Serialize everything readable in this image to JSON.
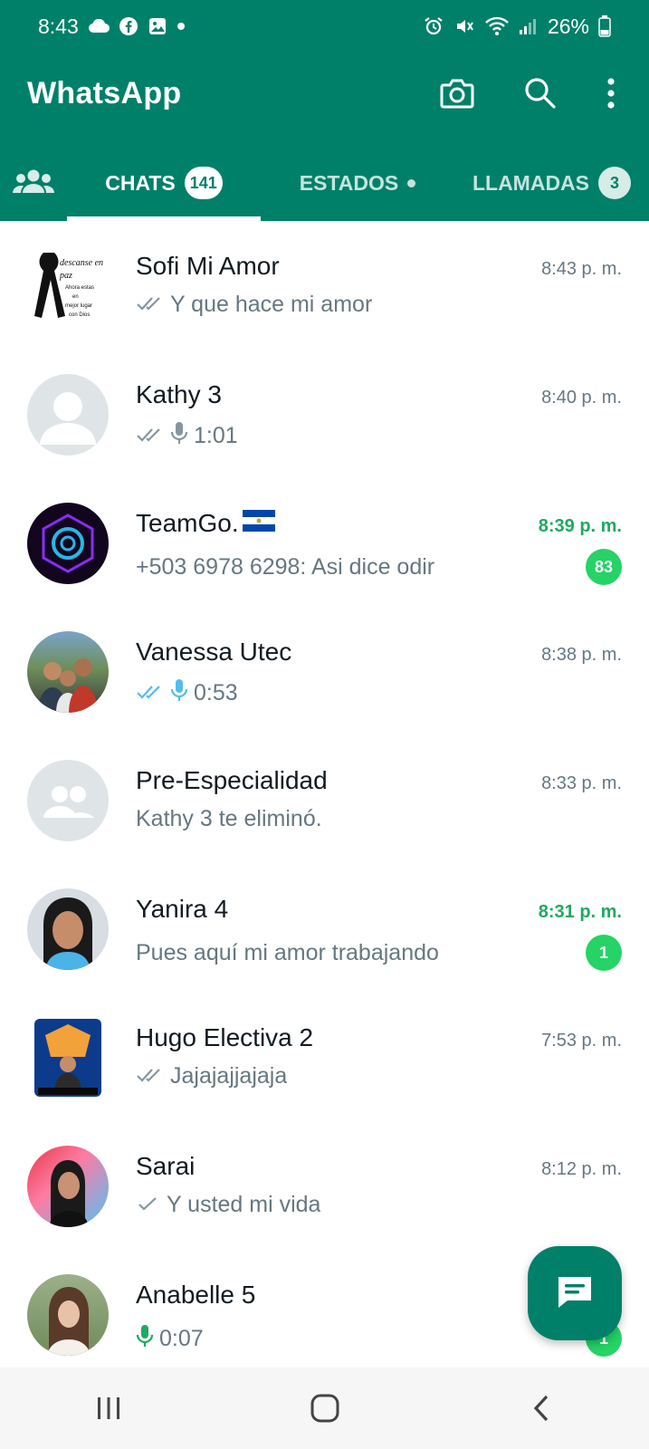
{
  "status_bar": {
    "time": "8:43",
    "battery": "26%",
    "left_icons": [
      "cloud-icon",
      "facebook-icon",
      "gallery-icon",
      "dot-icon"
    ],
    "right_icons": [
      "alarm-icon",
      "mute-icon",
      "wifi-icon",
      "signal-icon",
      "battery-icon"
    ]
  },
  "app": {
    "title": "WhatsApp",
    "brand_color": "#008069",
    "actions": [
      "camera-icon",
      "search-icon",
      "more-vert-icon"
    ]
  },
  "tabs": {
    "community_icon": "community-icon",
    "items": [
      {
        "label": "CHATS",
        "badge": "141",
        "active": true
      },
      {
        "label": "ESTADOS",
        "badge": "",
        "active": false
      },
      {
        "label": "LLAMADAS",
        "badge": "3",
        "active": false
      }
    ]
  },
  "chats": [
    {
      "name": "Sofi Mi Amor",
      "time": "8:43 p. m.",
      "preview": "Y que hace mi amor",
      "status": "read-gray",
      "unread": "",
      "avatar_text": "descanse en paz Ahora estas en mejor lugar con Dios"
    },
    {
      "name": "Kathy 3",
      "time": "8:40 p. m.",
      "preview": "1:01",
      "status": "read-gray",
      "mic": true,
      "unread": ""
    },
    {
      "name": "TeamGo.",
      "flag": "El Salvador flag",
      "time": "8:39 p. m.",
      "preview": "+503 6978 6298: Asi dice odir",
      "unread": "83"
    },
    {
      "name": "Vanessa Utec",
      "time": "8:38 p. m.",
      "preview": "0:53",
      "status": "read-blue",
      "mic": true,
      "unread": ""
    },
    {
      "name": "Pre-Especialidad",
      "time": "8:33 p. m.",
      "preview": "Kathy 3 te eliminó.",
      "unread": ""
    },
    {
      "name": "Yanira 4",
      "time": "8:31 p. m.",
      "preview": "Pues aquí mi amor trabajando",
      "unread": "1"
    },
    {
      "name": "Hugo Electiva 2",
      "time": "7:53 p. m.",
      "preview": "Jajajajjajaja",
      "status": "read-gray",
      "unread": ""
    },
    {
      "name": "Sarai",
      "time": "8:12 p. m.",
      "preview": "Y usted mi vida",
      "status": "sent",
      "unread": ""
    },
    {
      "name": "Anabelle 5",
      "time": "",
      "preview": "0:07",
      "mic": true,
      "mic_green": true,
      "unread": "1"
    }
  ],
  "fab": {
    "icon": "new-chat-icon"
  },
  "nav": [
    "recent-apps-icon",
    "home-icon",
    "back-icon"
  ]
}
